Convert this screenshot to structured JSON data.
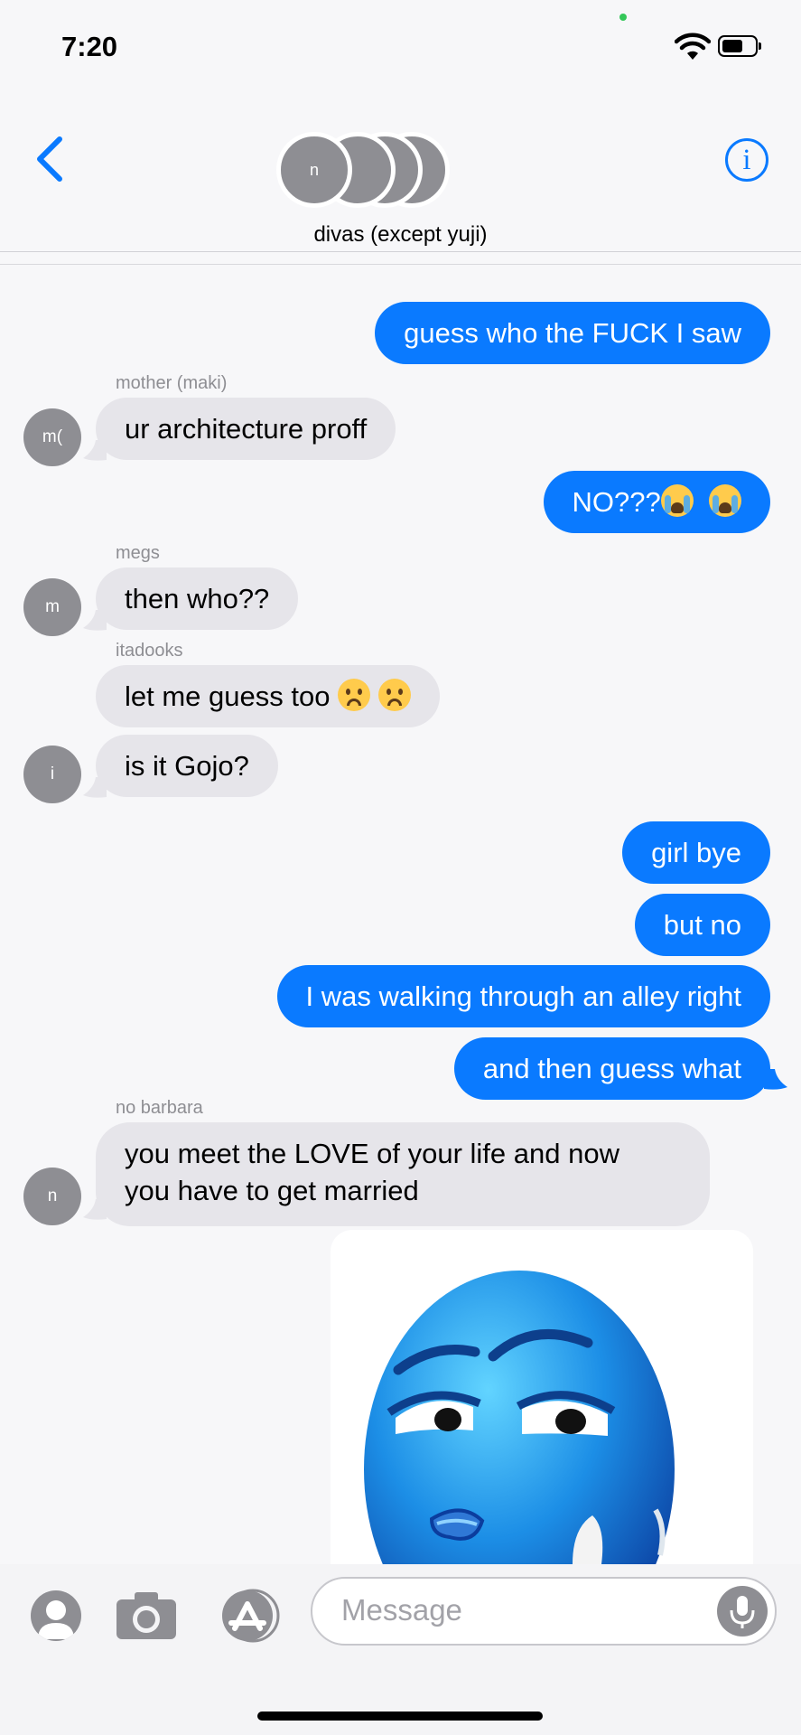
{
  "status": {
    "time": "7:20"
  },
  "header": {
    "group_name": "divas (except yuji)",
    "avatar_initial": "n",
    "back_icon": "chevron-left-icon",
    "info_icon": "info-icon",
    "info_glyph": "i"
  },
  "colors": {
    "outgoing": "#0a7aff",
    "incoming": "#e6e5ea",
    "accent": "#0a7aff"
  },
  "messages": {
    "m1": "guess who the FUCK I saw",
    "s2": "mother (maki)",
    "a2": "m(",
    "m2": "ur architecture proff",
    "m3": "NO???",
    "s4": "megs",
    "a4": "m",
    "m4": "then who??",
    "s5": "itadooks",
    "m5": "let me guess too",
    "a6": "i",
    "m6": "is it Gojo?",
    "m7": "girl bye",
    "m8": "but no",
    "m9": "I was walking through an alley right",
    "m10": "and then guess what",
    "s11": "no barbara",
    "a11": "n",
    "m11_line1": "you meet the LOVE of your life and now",
    "m11_line2": "you have to get married"
  },
  "compose": {
    "placeholder": "Message",
    "icons": [
      "contact-icon",
      "camera-icon",
      "app-store-icon",
      "microphone-icon"
    ]
  }
}
